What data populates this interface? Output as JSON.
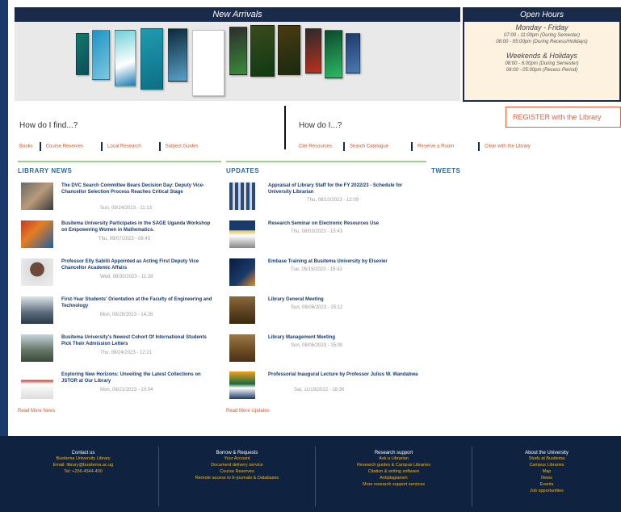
{
  "arrivals": {
    "title": "New Arrivals"
  },
  "hours": {
    "title": "Open Hours",
    "weekday_heading": "Monday - Friday",
    "weekday_times": [
      "07:00 - 11:00pm (During Semester)",
      "08:00 - 05:00pm (During Recess/Holidays)"
    ],
    "weekend_heading": "Weekends & Holidays",
    "weekend_times": [
      "08:00 - 6:00pm (During Semester)",
      "08:00 - 05:00pm (Recess Period)"
    ]
  },
  "find": {
    "heading": "How do I find...?",
    "links": [
      "Books",
      "Course Reserves",
      "Local Research",
      "Subject Guides"
    ]
  },
  "howdo": {
    "heading": "How do I...?",
    "links": [
      "Cite Resources",
      "Search Catalogue",
      "Reserve a Room",
      "Clear with the Library"
    ]
  },
  "register": {
    "label": "REGISTER with the Library"
  },
  "news": {
    "title": "LIBRARY NEWS",
    "read_more": "Read More News",
    "items": [
      {
        "title": "The DVC Search Committee Bears Decision Day: Deputy Vice-Chancellor Selection Process Reaches Critical Stage",
        "date": "Sun, 09/24/2023 - 11:13"
      },
      {
        "title": "Busitema University Participates in the SAGE Uganda Workshop on Empowering Women in Mathematics.",
        "date": "Thu, 09/07/2023 - 08:43"
      },
      {
        "title": "Professor Elly Sabiiti Appointed as Acting First Deputy Vice Chancellor Academic Affairs",
        "date": "Wed, 08/30/2023 - 11:28"
      },
      {
        "title": "First-Year Students' Orientation at the Faculty of Engineering and Technology",
        "date": "Mon, 08/28/2023 - 14:26"
      },
      {
        "title": "Busitema University's Newest Cohort Of International Students Pick Their Admission Letters",
        "date": "Thu, 08/24/2023 - 12:21"
      },
      {
        "title": "Exploring New Horizons: Unveiling the Latest Collections on JSTOR at Our Library",
        "date": "Mon, 08/21/2023 - 10:04"
      }
    ]
  },
  "updates": {
    "title": "UPDATES",
    "read_more": "Read More Updates",
    "items": [
      {
        "title": "Appraisal of Library Staff for the FY 2022/23 - Schedule for University Librarian",
        "date": "Thu, 08/10/2023 - 12:09"
      },
      {
        "title": "Research Seminar on Electronic Resources Use",
        "date": "Thu, 08/03/2023 - 15:43"
      },
      {
        "title": "Embase Training at Busitema University by Elsevier",
        "date": "Tue, 05/15/2023 - 15:42"
      },
      {
        "title": "Library General Meeting",
        "date": "Sun, 08/06/2023 - 15:12"
      },
      {
        "title": "Library Management Meeting",
        "date": "Sun, 08/06/2023 - 15:00"
      },
      {
        "title": "Professorial Inaugural Lecture by Professor Julius W. Wandabwa",
        "date": "Sat, 11/19/2022 - 18:30"
      }
    ]
  },
  "tweets": {
    "title": "TWEETS"
  },
  "footer": {
    "columns": [
      {
        "heading": "Contact us",
        "links": [
          "Busitema University Library",
          "Email: library@busitema.ac.ug",
          "Tel: +256-4544-400"
        ]
      },
      {
        "heading": "Borrow & Requests",
        "links": [
          "Your Account",
          "Document delivery service",
          "Course Reserves",
          "Remote access to E-journals & Databases"
        ]
      },
      {
        "heading": "Research support",
        "links": [
          "Ask a Librarian",
          "Research guides & Campus Libraries",
          "Citation & writing software",
          "Antiplagiarism",
          "More research support services"
        ]
      },
      {
        "heading": "About the University",
        "links": [
          "Study at Busitema",
          "Campus Libraries",
          "Map",
          "News",
          "Events",
          "Job opportunities"
        ]
      }
    ]
  },
  "colors": {
    "navy": "#1a2a4a",
    "accent": "#d2592a",
    "link_blue": "#1a3a6b",
    "green_rule": "#9fcf8a",
    "gold": "#f0b429"
  }
}
